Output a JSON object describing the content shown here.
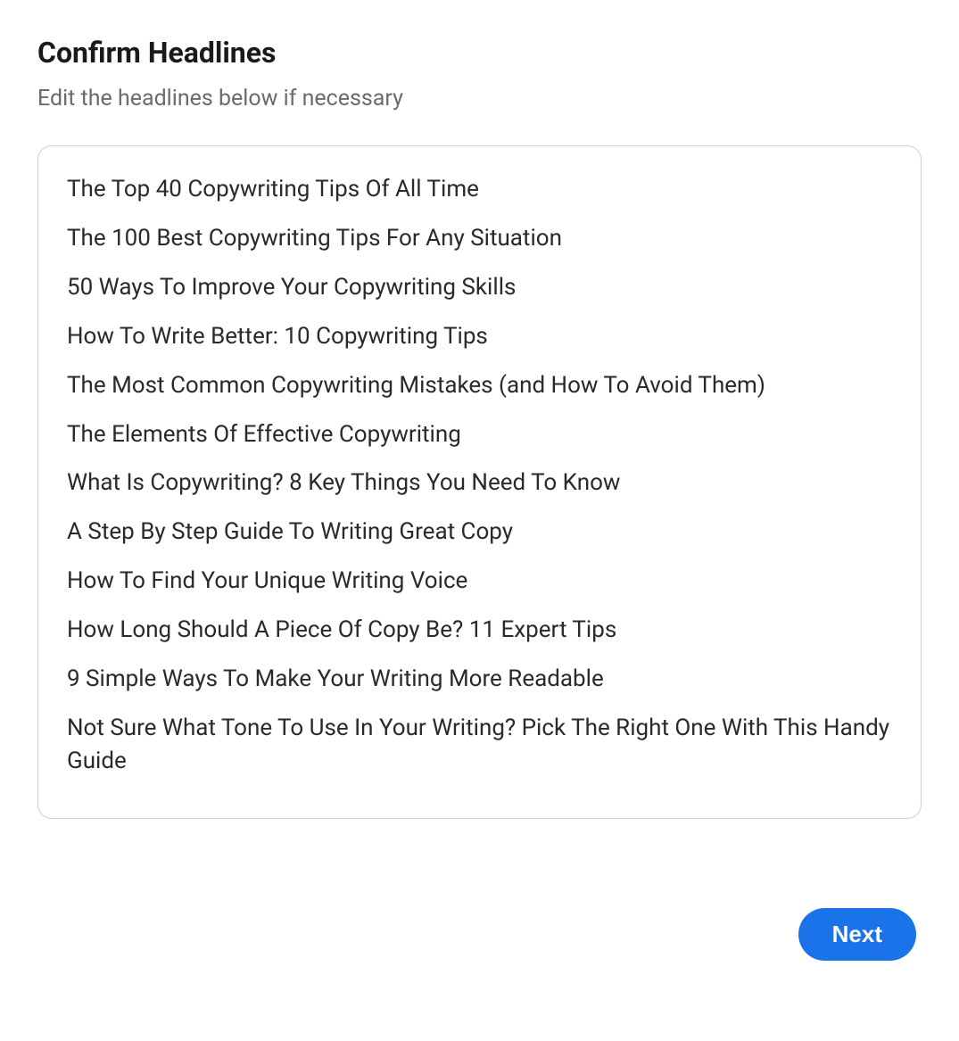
{
  "header": {
    "title": "Confirm Headlines",
    "subtitle": "Edit the headlines below if necessary"
  },
  "headlines": [
    "The Top 40 Copywriting Tips Of All Time",
    "The 100 Best Copywriting Tips For Any Situation",
    "50 Ways To Improve Your Copywriting Skills",
    "How To Write Better: 10 Copywriting Tips",
    "The Most Common Copywriting Mistakes (and How To Avoid Them)",
    "The Elements Of Effective Copywriting",
    "What Is Copywriting? 8 Key Things You Need To Know",
    "A Step By Step Guide To Writing Great Copy",
    "How To Find Your Unique Writing Voice",
    "How Long Should A Piece Of Copy Be? 11 Expert Tips",
    "9 Simple Ways To Make Your Writing More Readable",
    "Not Sure What Tone To Use In Your Writing? Pick The Right One With This Handy Guide"
  ],
  "footer": {
    "next_label": "Next"
  }
}
